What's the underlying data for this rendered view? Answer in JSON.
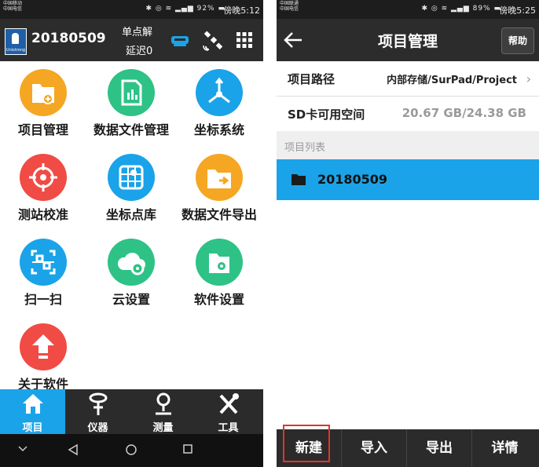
{
  "left": {
    "status": {
      "carrier1": "中国移动",
      "carrier2": "中国电信",
      "battery": "92%",
      "time": "傍晚5:12"
    },
    "header": {
      "project": "20180509",
      "solution": "单点解",
      "delay": "延迟0"
    },
    "apps": [
      {
        "label": "项目管理",
        "icon": "project-folder-icon",
        "color": "#f5a623"
      },
      {
        "label": "数据文件管理",
        "icon": "data-file-icon",
        "color": "#2ec286"
      },
      {
        "label": "坐标系统",
        "icon": "coordinate-axes-icon",
        "color": "#1aa3e8"
      },
      {
        "label": "测站校准",
        "icon": "target-icon",
        "color": "#f04b45"
      },
      {
        "label": "坐标点库",
        "icon": "map-point-icon",
        "color": "#1aa3e8"
      },
      {
        "label": "数据文件导出",
        "icon": "export-folder-icon",
        "color": "#f5a623"
      },
      {
        "label": "扫一扫",
        "icon": "qr-scan-icon",
        "color": "#1aa3e8"
      },
      {
        "label": "云设置",
        "icon": "cloud-settings-icon",
        "color": "#2ec286"
      },
      {
        "label": "软件设置",
        "icon": "software-settings-icon",
        "color": "#2ec286"
      },
      {
        "label": "关于软件",
        "icon": "upload-arrow-icon",
        "color": "#f04b45"
      }
    ],
    "nav": [
      {
        "label": "项目",
        "icon": "home-icon",
        "active": true
      },
      {
        "label": "仪器",
        "icon": "instrument-icon",
        "active": false
      },
      {
        "label": "测量",
        "icon": "map-pin-icon",
        "active": false
      },
      {
        "label": "工具",
        "icon": "tools-icon",
        "active": false
      }
    ]
  },
  "right": {
    "status": {
      "carrier1": "中国联通",
      "carrier2": "中国电信",
      "battery": "89%",
      "time": "傍晚5:25"
    },
    "title": "项目管理",
    "help": "帮助",
    "path_label": "项目路径",
    "path_value": "内部存储/SurPad/Project",
    "sd_label": "SD卡可用空间",
    "sd_value": "20.67 GB/24.38 GB",
    "list_header": "项目列表",
    "projects": [
      "20180509"
    ],
    "buttons": [
      "新建",
      "导入",
      "导出",
      "详情"
    ]
  },
  "colors": {
    "accent": "#1aa3e8",
    "highlight": "#e0352b",
    "bar": "#2c2c2c"
  }
}
